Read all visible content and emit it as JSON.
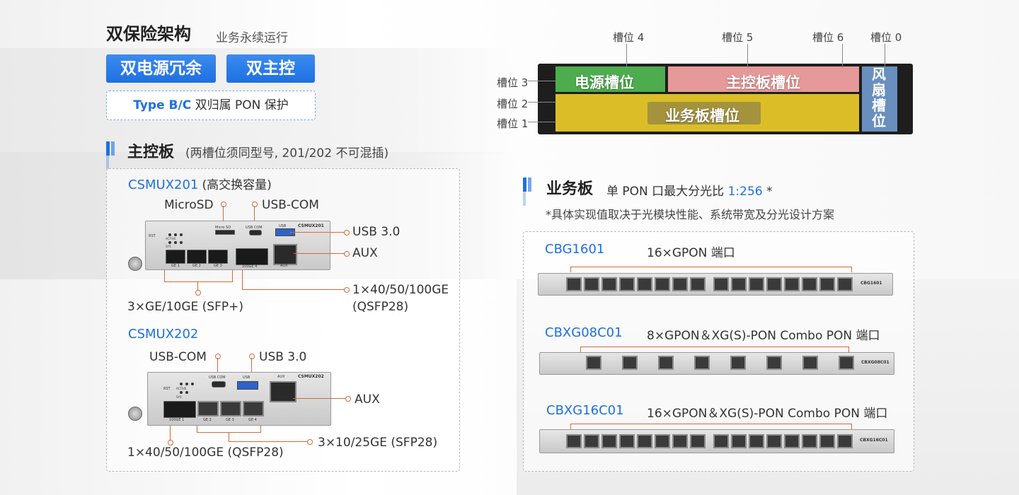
{
  "header": {
    "title": "双保险架构",
    "subtitle": "业务永续运行",
    "pill1": "双电源冗余",
    "pill2": "双主控",
    "typeb_blue": "Type B/C",
    "typeb_rest": "双归属 PON 保护"
  },
  "chassis": {
    "slot4": "槽位 4",
    "slot5": "槽位 5",
    "slot6": "槽位 6",
    "slot0": "槽位 0",
    "slot3": "槽位 3",
    "slot2": "槽位 2",
    "slot1": "槽位 1",
    "power_slot": "电源槽位",
    "main_slot": "主控板槽位",
    "service_slot": "业务板槽位",
    "fan_slot": [
      "风",
      "扇",
      "槽",
      "位"
    ]
  },
  "main_section": {
    "title": "主控板",
    "note": "(两槽位须同型号, 201/202 不可混插)",
    "card1": {
      "name": "CSMUX201",
      "suffix": "(高交换容量)",
      "microsd": "MicroSD",
      "usbcom": "USB-COM",
      "usb30": "USB 3.0",
      "aux": "AUX",
      "ge": "3×GE/10GE (SFP+)",
      "qsfp_line1": "1×40/50/100GE",
      "qsfp_line2": "(QSFP28)",
      "silk_name": "CSMUX201",
      "silk_ge1": "GE 1",
      "silk_ge2": "GE 2",
      "silk_ge3": "GE 3",
      "silk_100ge": "100GE 4",
      "silk_aux": "AUX",
      "silk_microsd": "Micro SD",
      "silk_usbcom": "USB COM",
      "silk_usb": "USB",
      "silk_rst": "RST",
      "silk_active": "ACTIVE",
      "silk_sys": "SYS"
    },
    "card2": {
      "name": "CSMUX202",
      "usbcom": "USB-COM",
      "usb30": "USB 3.0",
      "aux": "AUX",
      "sfp28": "3×10/25GE (SFP28)",
      "qsfp": "1×40/50/100GE (QSFP28)",
      "silk_name": "CSMUX202",
      "silk_100ge": "100GE 1",
      "silk_ge2": "GE 2",
      "silk_ge3": "GE 3",
      "silk_ge4": "GE 4",
      "silk_usbcom": "USB COM",
      "silk_usb": "USB",
      "silk_aux": "AUX",
      "silk_rst": "RST",
      "silk_active": "ACTIVE",
      "silk_sys": "SYS"
    }
  },
  "service_section": {
    "title": "业务板",
    "note_pre": "单 PON 口最大分光比",
    "ratio": "1:256",
    "star": "*",
    "footnote": "*具体实现值取决于光模块性能、系统带宽及分光设计方案",
    "cards": [
      {
        "name": "CBG1601",
        "desc": "16×GPON 端口",
        "silk": "CBG1601"
      },
      {
        "name": "CBXG08C01",
        "desc": "8×GPON＆XG(S)-PON Combo PON 端口",
        "silk": "CBXG08C01"
      },
      {
        "name": "CBXG16C01",
        "desc": "16×GPON＆XG(S)-PON Combo PON 端口",
        "silk": "CBXG16C01"
      }
    ]
  }
}
